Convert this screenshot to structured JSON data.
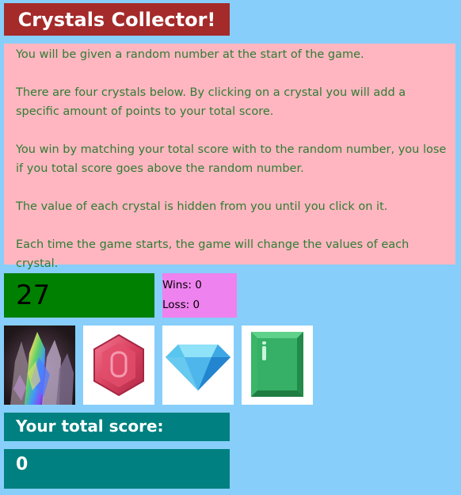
{
  "title": "Crystals Collector!",
  "instructions": [
    "You will be given a random number at the start of the game.",
    "There are four crystals below. By clicking on a crystal you will add a specific amount of points to your total score.",
    "You win by matching your total score with to the random number, you lose if you total score goes above the random number.",
    "The value of each crystal is hidden from you until you click on it.",
    "Each time the game starts, the game will change the values of each crystal."
  ],
  "target_number": "27",
  "stats": {
    "wins": "Wins: 0",
    "losses": "Loss: 0"
  },
  "crystals": [
    {
      "icon": "rainbow-crystal-cluster-icon"
    },
    {
      "icon": "red-hexagon-gem-icon"
    },
    {
      "icon": "blue-diamond-icon"
    },
    {
      "icon": "green-rectangle-gem-icon"
    }
  ],
  "score": {
    "label": "Your total score:",
    "value": "0"
  },
  "colors": {
    "background": "#87cefa",
    "title_bg": "#a52a2a",
    "instructions_bg": "#ffb6c1",
    "instructions_text": "#2e7d32",
    "target_bg": "#008000",
    "stats_bg": "#ee82ee",
    "score_bg": "#008080"
  }
}
